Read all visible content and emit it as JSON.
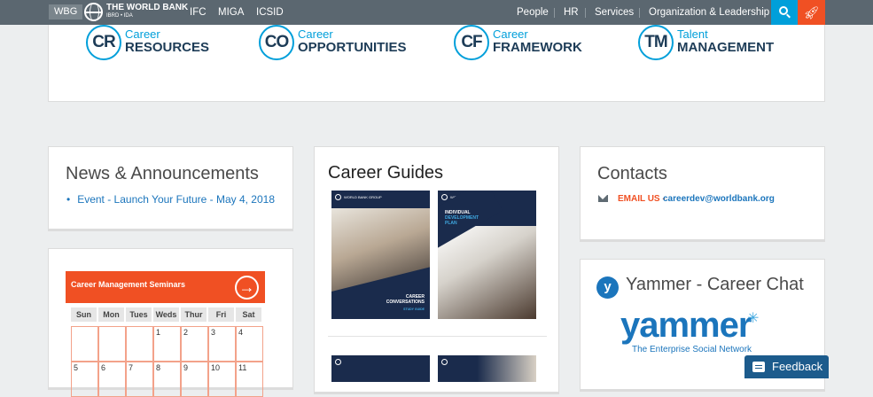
{
  "topnav": {
    "wbg": "WBG",
    "brand_name": "THE WORLD BANK",
    "brand_sub": "IBRD • IDA",
    "links_left": [
      "IFC",
      "MIGA",
      "ICSID"
    ],
    "links_right": [
      "People",
      "HR",
      "Services",
      "Organization & Leadership"
    ],
    "search_icon": "search-icon",
    "rocket_icon": "rocket-icon"
  },
  "logos": [
    {
      "abbr": "CR",
      "line1": "Career",
      "line2": "RESOURCES"
    },
    {
      "abbr": "CO",
      "line1": "Career",
      "line2": "OPPORTUNITIES"
    },
    {
      "abbr": "CF",
      "line1": "Career",
      "line2": "FRAMEWORK"
    },
    {
      "abbr": "TM",
      "line1": "Talent",
      "line2": "MANAGEMENT"
    }
  ],
  "news": {
    "title": "News & Announcements",
    "items": [
      "Event - Launch Your Future - May 4, 2018"
    ]
  },
  "calendar": {
    "title": "Career Management Seminars",
    "days": [
      "Sun",
      "Mon",
      "Tues",
      "Weds",
      "Thur",
      "Fri",
      "Sat"
    ],
    "row1": [
      "",
      "",
      "",
      "1",
      "2",
      "3",
      "4"
    ],
    "row2": [
      "5",
      "6",
      "7",
      "8",
      "9",
      "10",
      "11"
    ]
  },
  "guides": {
    "title": "Career Guides",
    "brand": "WORLD BANK GROUP",
    "guide1": {
      "line1": "CAREER",
      "line2": "CONVERSATIONS",
      "line3": "STUDY GUIDE"
    },
    "guide2": {
      "line1": "INDIVIDUAL",
      "line2": "DEVELOPMENT",
      "line3": "PLAN"
    }
  },
  "contacts": {
    "title": "Contacts",
    "email_label": "EMAIL US -",
    "email": "careerdev@worldbank.org"
  },
  "yammer": {
    "title": "Yammer - Career Chat",
    "logo_word": "yammer",
    "tagline": "The Enterprise Social Network"
  },
  "feedback": {
    "label": "Feedback"
  },
  "colors": {
    "nav_bg": "#5b6770",
    "accent_blue": "#009fda",
    "accent_orange": "#f05023",
    "link_blue": "#1b75bc"
  }
}
